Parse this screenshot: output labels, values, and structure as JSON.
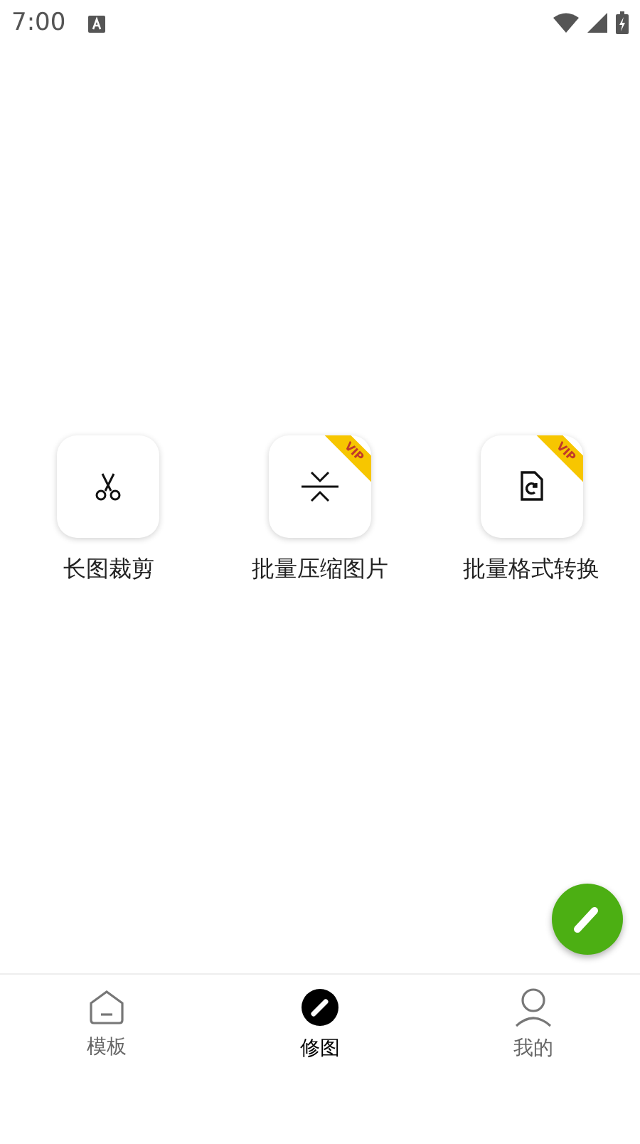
{
  "status_bar": {
    "time": "7:00"
  },
  "tools": [
    {
      "kind": "scissors",
      "label": "长图裁剪"
    },
    {
      "kind": "compress",
      "label": "批量压缩图片",
      "badge": "VIP"
    },
    {
      "kind": "file-sync",
      "label": "批量格式转换",
      "badge": "VIP"
    }
  ],
  "tabs": [
    {
      "kind": "home",
      "label": "模板",
      "selected": false
    },
    {
      "kind": "edit",
      "label": "修图",
      "selected": true
    },
    {
      "kind": "user",
      "label": "我的",
      "selected": false
    }
  ]
}
